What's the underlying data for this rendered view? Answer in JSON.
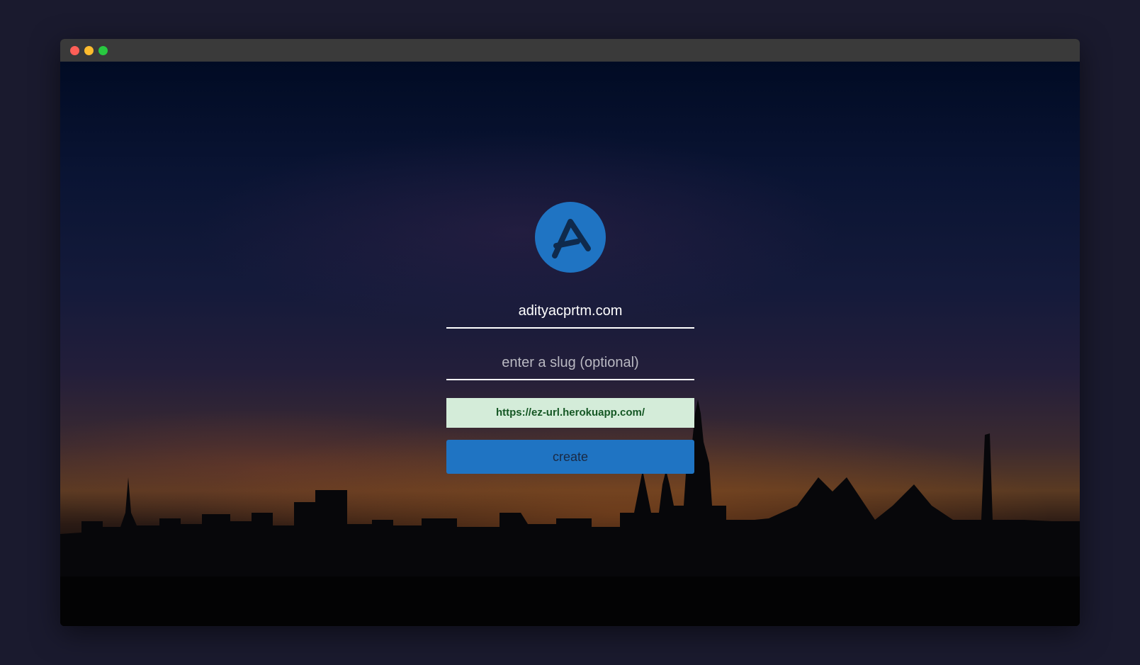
{
  "window": {
    "controls": [
      "close",
      "minimize",
      "maximize"
    ]
  },
  "logo": {
    "icon": "a-logo-icon",
    "color": "#1f74c3"
  },
  "form": {
    "url_value": "adityacprtm.com",
    "slug_placeholder": "enter a slug (optional)",
    "result_url": "https://ez-url.herokuapp.com/",
    "create_label": "create"
  },
  "colors": {
    "accent": "#1f74c3",
    "success_bg": "#d4ecd9",
    "success_text": "#155724"
  }
}
